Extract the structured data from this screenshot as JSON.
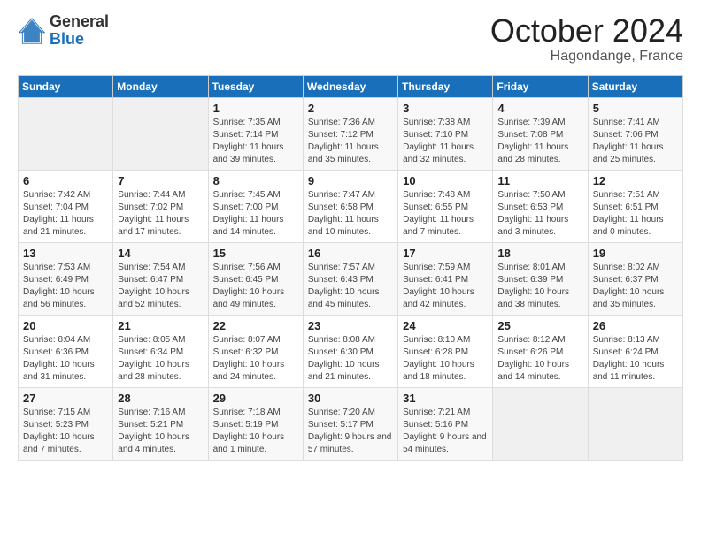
{
  "logo": {
    "general": "General",
    "blue": "Blue"
  },
  "title": "October 2024",
  "location": "Hagondange, France",
  "days_header": [
    "Sunday",
    "Monday",
    "Tuesday",
    "Wednesday",
    "Thursday",
    "Friday",
    "Saturday"
  ],
  "weeks": [
    [
      {
        "num": "",
        "detail": ""
      },
      {
        "num": "",
        "detail": ""
      },
      {
        "num": "1",
        "detail": "Sunrise: 7:35 AM\nSunset: 7:14 PM\nDaylight: 11 hours and 39 minutes."
      },
      {
        "num": "2",
        "detail": "Sunrise: 7:36 AM\nSunset: 7:12 PM\nDaylight: 11 hours and 35 minutes."
      },
      {
        "num": "3",
        "detail": "Sunrise: 7:38 AM\nSunset: 7:10 PM\nDaylight: 11 hours and 32 minutes."
      },
      {
        "num": "4",
        "detail": "Sunrise: 7:39 AM\nSunset: 7:08 PM\nDaylight: 11 hours and 28 minutes."
      },
      {
        "num": "5",
        "detail": "Sunrise: 7:41 AM\nSunset: 7:06 PM\nDaylight: 11 hours and 25 minutes."
      }
    ],
    [
      {
        "num": "6",
        "detail": "Sunrise: 7:42 AM\nSunset: 7:04 PM\nDaylight: 11 hours and 21 minutes."
      },
      {
        "num": "7",
        "detail": "Sunrise: 7:44 AM\nSunset: 7:02 PM\nDaylight: 11 hours and 17 minutes."
      },
      {
        "num": "8",
        "detail": "Sunrise: 7:45 AM\nSunset: 7:00 PM\nDaylight: 11 hours and 14 minutes."
      },
      {
        "num": "9",
        "detail": "Sunrise: 7:47 AM\nSunset: 6:58 PM\nDaylight: 11 hours and 10 minutes."
      },
      {
        "num": "10",
        "detail": "Sunrise: 7:48 AM\nSunset: 6:55 PM\nDaylight: 11 hours and 7 minutes."
      },
      {
        "num": "11",
        "detail": "Sunrise: 7:50 AM\nSunset: 6:53 PM\nDaylight: 11 hours and 3 minutes."
      },
      {
        "num": "12",
        "detail": "Sunrise: 7:51 AM\nSunset: 6:51 PM\nDaylight: 11 hours and 0 minutes."
      }
    ],
    [
      {
        "num": "13",
        "detail": "Sunrise: 7:53 AM\nSunset: 6:49 PM\nDaylight: 10 hours and 56 minutes."
      },
      {
        "num": "14",
        "detail": "Sunrise: 7:54 AM\nSunset: 6:47 PM\nDaylight: 10 hours and 52 minutes."
      },
      {
        "num": "15",
        "detail": "Sunrise: 7:56 AM\nSunset: 6:45 PM\nDaylight: 10 hours and 49 minutes."
      },
      {
        "num": "16",
        "detail": "Sunrise: 7:57 AM\nSunset: 6:43 PM\nDaylight: 10 hours and 45 minutes."
      },
      {
        "num": "17",
        "detail": "Sunrise: 7:59 AM\nSunset: 6:41 PM\nDaylight: 10 hours and 42 minutes."
      },
      {
        "num": "18",
        "detail": "Sunrise: 8:01 AM\nSunset: 6:39 PM\nDaylight: 10 hours and 38 minutes."
      },
      {
        "num": "19",
        "detail": "Sunrise: 8:02 AM\nSunset: 6:37 PM\nDaylight: 10 hours and 35 minutes."
      }
    ],
    [
      {
        "num": "20",
        "detail": "Sunrise: 8:04 AM\nSunset: 6:36 PM\nDaylight: 10 hours and 31 minutes."
      },
      {
        "num": "21",
        "detail": "Sunrise: 8:05 AM\nSunset: 6:34 PM\nDaylight: 10 hours and 28 minutes."
      },
      {
        "num": "22",
        "detail": "Sunrise: 8:07 AM\nSunset: 6:32 PM\nDaylight: 10 hours and 24 minutes."
      },
      {
        "num": "23",
        "detail": "Sunrise: 8:08 AM\nSunset: 6:30 PM\nDaylight: 10 hours and 21 minutes."
      },
      {
        "num": "24",
        "detail": "Sunrise: 8:10 AM\nSunset: 6:28 PM\nDaylight: 10 hours and 18 minutes."
      },
      {
        "num": "25",
        "detail": "Sunrise: 8:12 AM\nSunset: 6:26 PM\nDaylight: 10 hours and 14 minutes."
      },
      {
        "num": "26",
        "detail": "Sunrise: 8:13 AM\nSunset: 6:24 PM\nDaylight: 10 hours and 11 minutes."
      }
    ],
    [
      {
        "num": "27",
        "detail": "Sunrise: 7:15 AM\nSunset: 5:23 PM\nDaylight: 10 hours and 7 minutes."
      },
      {
        "num": "28",
        "detail": "Sunrise: 7:16 AM\nSunset: 5:21 PM\nDaylight: 10 hours and 4 minutes."
      },
      {
        "num": "29",
        "detail": "Sunrise: 7:18 AM\nSunset: 5:19 PM\nDaylight: 10 hours and 1 minute."
      },
      {
        "num": "30",
        "detail": "Sunrise: 7:20 AM\nSunset: 5:17 PM\nDaylight: 9 hours and 57 minutes."
      },
      {
        "num": "31",
        "detail": "Sunrise: 7:21 AM\nSunset: 5:16 PM\nDaylight: 9 hours and 54 minutes."
      },
      {
        "num": "",
        "detail": ""
      },
      {
        "num": "",
        "detail": ""
      }
    ]
  ]
}
